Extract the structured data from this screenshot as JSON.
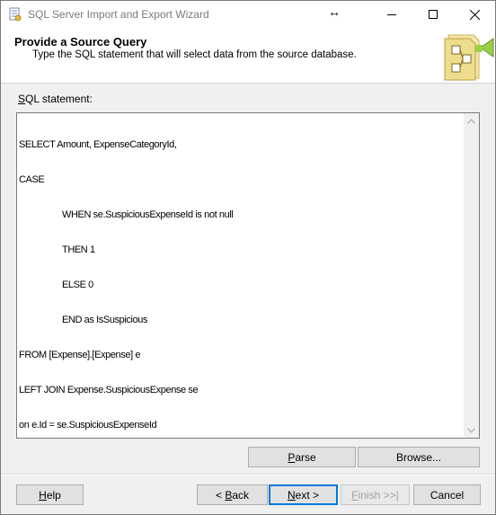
{
  "window": {
    "title": "SQL Server Import and Export Wizard",
    "resize_glyph": "↔"
  },
  "header": {
    "title": "Provide a Source Query",
    "subtitle": "Type the SQL statement that will select data from the source database."
  },
  "sql": {
    "label_mnemonic": "S",
    "label_rest": "QL statement:",
    "lines": [
      "SELECT Amount, ExpenseCategoryId,",
      "CASE",
      "WHEN se.SuspiciousExpenseId is not null",
      "THEN 1",
      "ELSE 0",
      "END as IsSuspicious",
      "FROM [Expense].[Expense] e",
      "LEFT JOIN Expense.SuspiciousExpense se",
      "on e.Id = se.SuspiciousExpenseId"
    ]
  },
  "buttons": {
    "parse": {
      "mnemonic": "P",
      "rest": "arse"
    },
    "browse": {
      "mnemonic": "",
      "rest": "Browse..."
    },
    "help": {
      "mnemonic": "H",
      "rest": "elp"
    },
    "back": {
      "prefix": "< ",
      "mnemonic": "B",
      "rest": "ack"
    },
    "next": {
      "mnemonic": "N",
      "rest": "ext >"
    },
    "finish": {
      "mnemonic": "F",
      "rest": "inish >>|"
    },
    "cancel": {
      "mnemonic": "",
      "rest": "Cancel"
    }
  },
  "colors": {
    "default_button_border": "#0078d7",
    "header_background": "#ffffff",
    "dialog_background": "#f0f0f0"
  }
}
